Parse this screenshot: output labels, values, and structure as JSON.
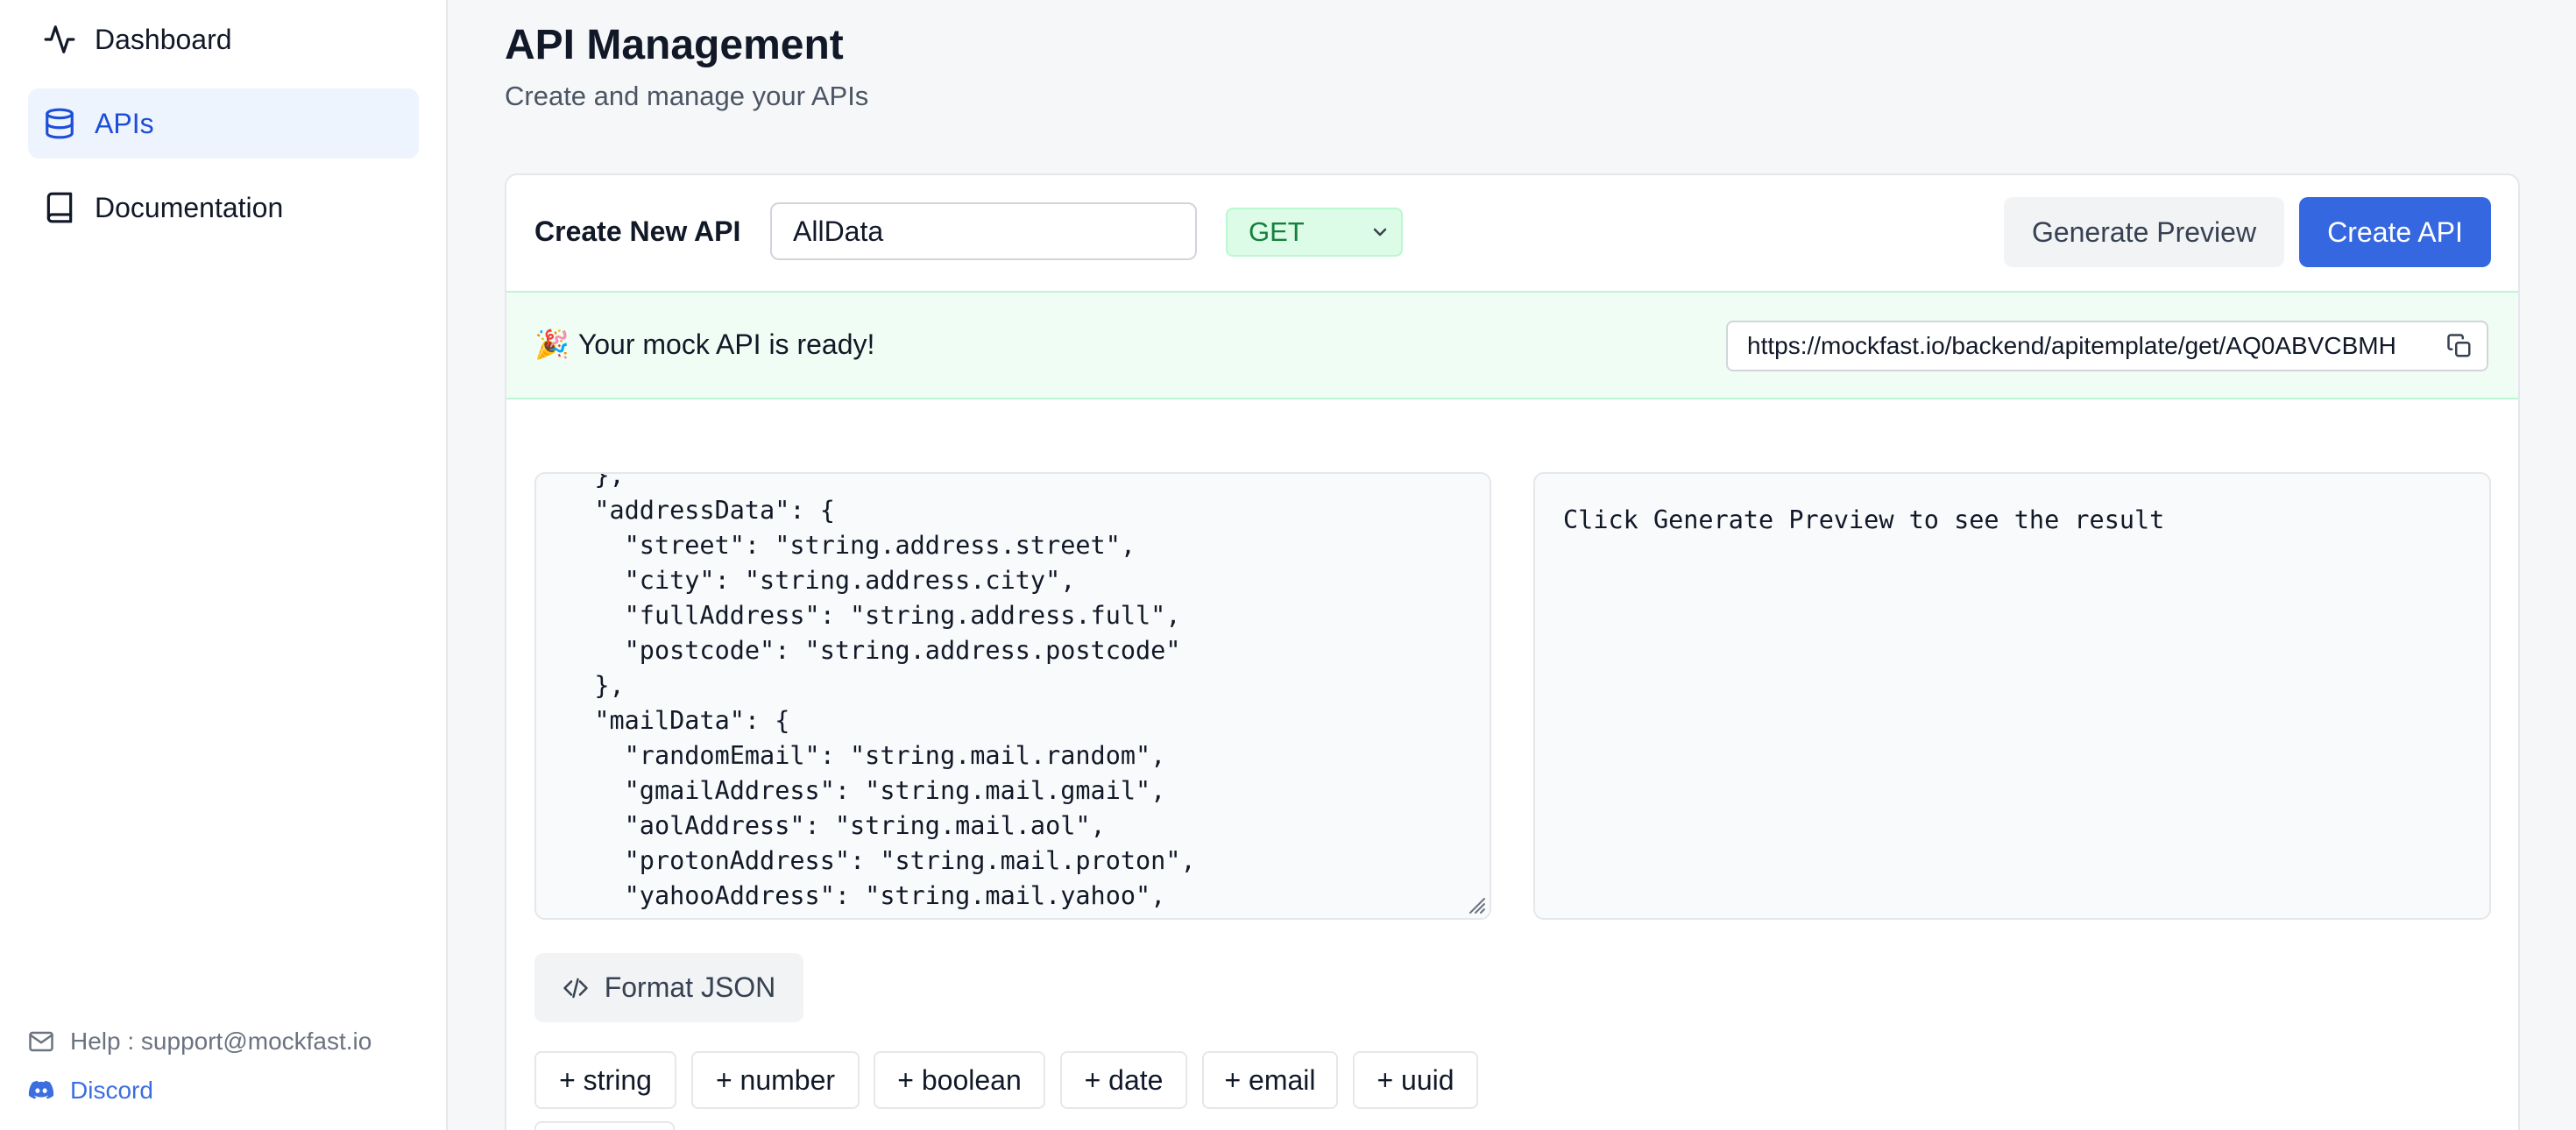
{
  "sidebar": {
    "items": [
      {
        "label": "Dashboard",
        "icon": "activity-icon"
      },
      {
        "label": "APIs",
        "icon": "database-icon"
      },
      {
        "label": "Documentation",
        "icon": "book-icon"
      }
    ],
    "help_text": "Help : support@mockfast.io",
    "discord_text": "Discord"
  },
  "header": {
    "title": "API Management",
    "subtitle": "Create and manage your APIs"
  },
  "create": {
    "label": "Create New API",
    "name_value": "AllData",
    "method_value": "GET",
    "generate_preview_label": "Generate Preview",
    "create_api_label": "Create API"
  },
  "banner": {
    "emoji": "🎉",
    "message": "Your mock API is ready!",
    "url": "https://mockfast.io/backend/apitemplate/get/AQ0ABVCBMH"
  },
  "editor": {
    "content": "  },\n  \"addressData\": {\n    \"street\": \"string.address.street\",\n    \"city\": \"string.address.city\",\n    \"fullAddress\": \"string.address.full\",\n    \"postcode\": \"string.address.postcode\"\n  },\n  \"mailData\": {\n    \"randomEmail\": \"string.mail.random\",\n    \"gmailAddress\": \"string.mail.gmail\",\n    \"aolAddress\": \"string.mail.aol\",\n    \"protonAddress\": \"string.mail.proton\",\n    \"yahooAddress\": \"string.mail.yahoo\","
  },
  "preview": {
    "message": "Click Generate Preview to see the result"
  },
  "format_json_label": "Format JSON",
  "type_chips": [
    "+ string",
    "+ number",
    "+ boolean",
    "+ date",
    "+ email",
    "+ uuid"
  ],
  "colors": {
    "accent": "#3568e0",
    "active_nav_bg": "#eef4fd",
    "success_bg": "#f0fdf4",
    "method_bg": "#dcfce7",
    "method_text": "#15803d"
  }
}
